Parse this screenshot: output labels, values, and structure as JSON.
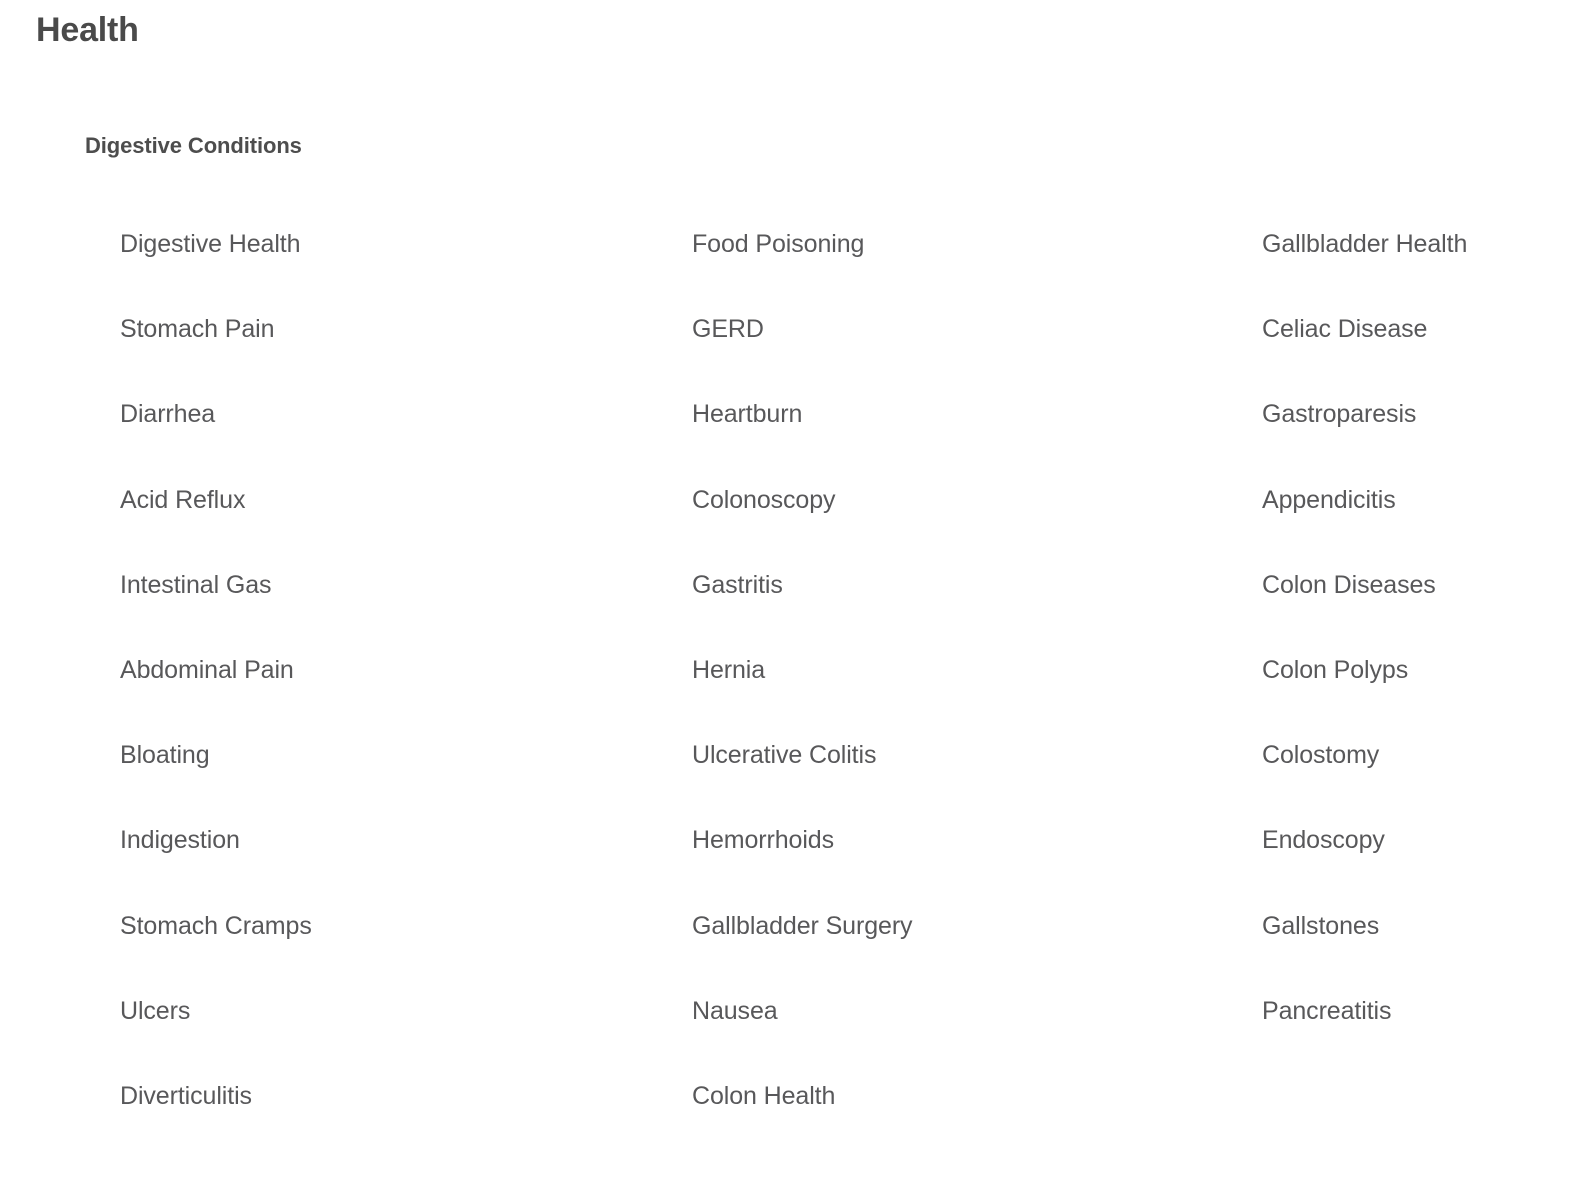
{
  "page": {
    "title": "Health",
    "background_color": "#ffffff",
    "heading_color": "#4a4a4a",
    "link_color": "#58585a"
  },
  "section": {
    "title": "Digestive Conditions",
    "columns": [
      {
        "id": "column-1",
        "items": [
          {
            "label": "Digestive Health"
          },
          {
            "label": "Stomach Pain"
          },
          {
            "label": "Diarrhea"
          },
          {
            "label": "Acid Reflux"
          },
          {
            "label": "Intestinal Gas"
          },
          {
            "label": "Abdominal Pain"
          },
          {
            "label": "Bloating"
          },
          {
            "label": "Indigestion"
          },
          {
            "label": "Stomach Cramps"
          },
          {
            "label": "Ulcers"
          },
          {
            "label": "Diverticulitis"
          }
        ]
      },
      {
        "id": "column-2",
        "items": [
          {
            "label": "Food Poisoning"
          },
          {
            "label": "GERD"
          },
          {
            "label": "Heartburn"
          },
          {
            "label": "Colonoscopy"
          },
          {
            "label": "Gastritis"
          },
          {
            "label": "Hernia"
          },
          {
            "label": "Ulcerative Colitis"
          },
          {
            "label": "Hemorrhoids"
          },
          {
            "label": "Gallbladder Surgery"
          },
          {
            "label": "Nausea"
          },
          {
            "label": "Colon Health"
          }
        ]
      },
      {
        "id": "column-3",
        "items": [
          {
            "label": "Gallbladder Health"
          },
          {
            "label": "Celiac Disease"
          },
          {
            "label": "Gastroparesis"
          },
          {
            "label": "Appendicitis"
          },
          {
            "label": "Colon Diseases"
          },
          {
            "label": "Colon Polyps"
          },
          {
            "label": "Colostomy"
          },
          {
            "label": "Endoscopy"
          },
          {
            "label": "Gallstones"
          },
          {
            "label": "Pancreatitis"
          }
        ]
      }
    ]
  }
}
